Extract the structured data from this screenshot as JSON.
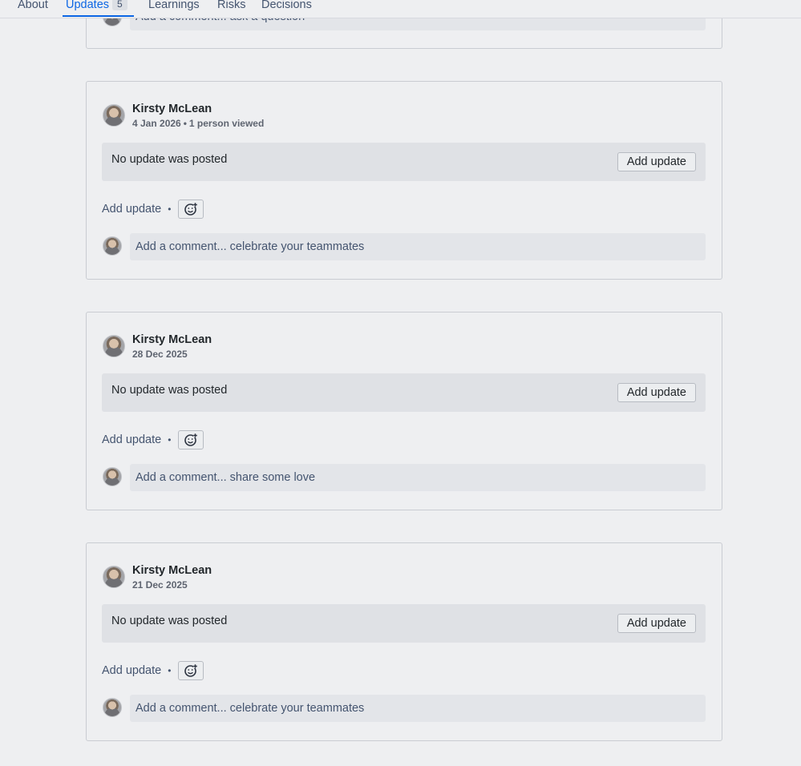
{
  "tabs": [
    {
      "label": "About"
    },
    {
      "label": "Updates",
      "count": "5",
      "active": true
    },
    {
      "label": "Learnings"
    },
    {
      "label": "Risks"
    },
    {
      "label": "Decisions"
    }
  ],
  "top_card": {
    "comment_placeholder": "Add a comment... ask a question"
  },
  "updates": [
    {
      "author": "Kirsty McLean",
      "date": "4 Jan 2026",
      "views": "1 person viewed",
      "panel_text": "No update was posted",
      "add_update_button": "Add update",
      "action_link": "Add update",
      "comment_placeholder": "Add a comment... celebrate your teammates"
    },
    {
      "author": "Kirsty McLean",
      "date": "28 Dec 2025",
      "panel_text": "No update was posted",
      "add_update_button": "Add update",
      "action_link": "Add update",
      "comment_placeholder": "Add a comment... share some love"
    },
    {
      "author": "Kirsty McLean",
      "date": "21 Dec 2025",
      "panel_text": "No update was posted",
      "add_update_button": "Add update",
      "action_link": "Add update",
      "comment_placeholder": "Add a comment... celebrate your teammates"
    }
  ],
  "bullet": "•",
  "icons": {
    "reaction": "add-reaction-icon",
    "avatar": "user-avatar"
  },
  "colors": {
    "accent": "#0c66e4",
    "background": "#eeeff1",
    "panel": "#dfe1e5"
  }
}
